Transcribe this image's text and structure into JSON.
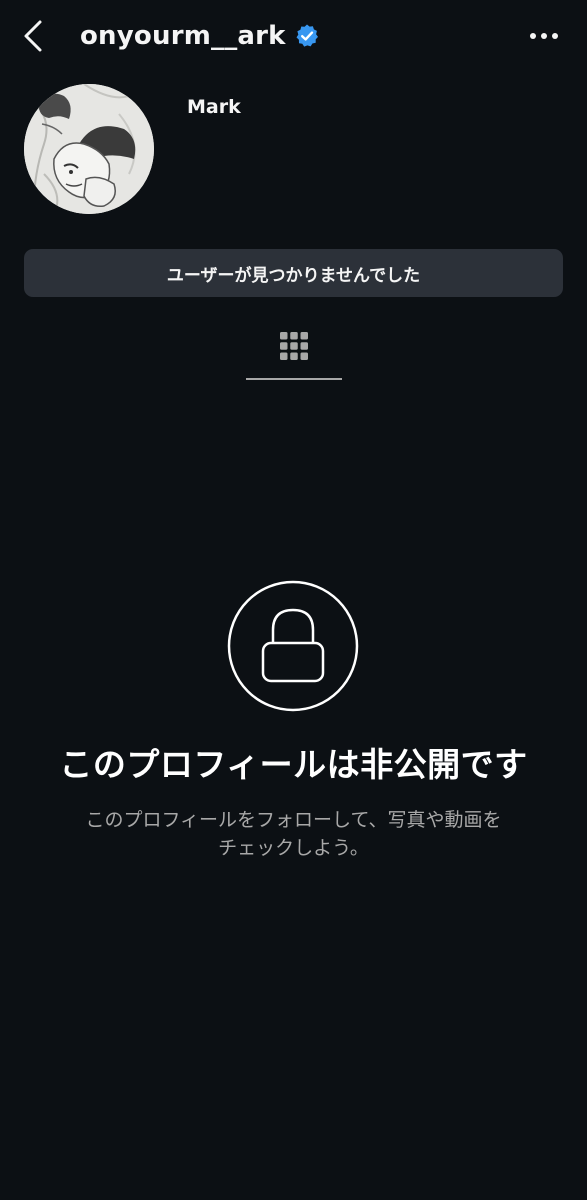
{
  "header": {
    "username": "onyourm__ark",
    "back_icon": "chevron-left-icon",
    "verified_icon": "verified-badge-icon",
    "verified_color": "#3897f0",
    "more_icon": "more-horizontal-icon"
  },
  "profile": {
    "display_name": "Mark",
    "avatar_icon": "avatar-sketch-image"
  },
  "notice": {
    "text": "ユーザーが見つかりませんでした"
  },
  "tabs": {
    "grid_icon": "grid-icon"
  },
  "private": {
    "lock_icon": "lock-icon",
    "title": "このプロフィールは非公開です",
    "subtitle_line1": "このプロフィールをフォローして、写真や動画を",
    "subtitle_line2": "チェックしよう。"
  },
  "colors": {
    "background": "#0c1014",
    "notice_bg": "#2c3139",
    "text_primary": "#f5f5f5",
    "text_secondary": "#a8a8a8"
  }
}
